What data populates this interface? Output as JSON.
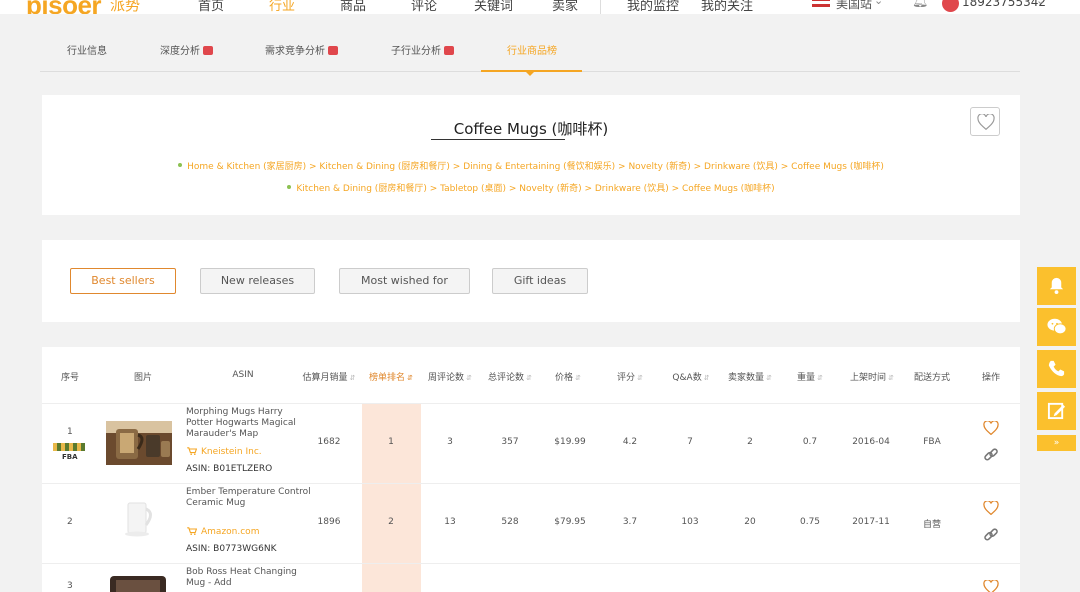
{
  "topnav": {
    "logo": "pisoer",
    "logo_cn": "派势",
    "items": [
      "首页",
      "行业",
      "商品",
      "评论",
      "关键词",
      "卖家",
      "我的监控",
      "我的关注"
    ],
    "active_index": 1,
    "country": "美国站",
    "phone": "18923755342"
  },
  "subtabs": {
    "items": [
      "行业信息",
      "深度分析",
      "需求竞争分析",
      "子行业分析",
      "行业商品榜"
    ],
    "vip": [
      false,
      true,
      true,
      true,
      false
    ],
    "active_index": 4
  },
  "category": {
    "title": "Coffee Mugs (咖啡杯)",
    "breadcrumbs": [
      "Home & Kitchen (家居厨房) > Kitchen & Dining (厨房和餐厅) > Dining & Entertaining (餐饮和娱乐) > Novelty (新奇) > Drinkware (饮具) > Coffee Mugs (咖啡杯)",
      "Kitchen & Dining (厨房和餐厅) > Tabletop (桌面) > Novelty (新奇) > Drinkware (饮具) > Coffee Mugs (咖啡杯)"
    ]
  },
  "filters": {
    "items": [
      "Best sellers",
      "New releases",
      "Most wished for",
      "Gift ideas"
    ],
    "active_index": 0
  },
  "table": {
    "headers": [
      "序号",
      "图片",
      "ASIN",
      "估算月销量",
      "榜单排名",
      "周评论数",
      "总评论数",
      "价格",
      "评分",
      "Q&A数",
      "卖家数量",
      "重量",
      "上架时间",
      "配送方式",
      "操作"
    ],
    "sortable": [
      false,
      false,
      false,
      true,
      true,
      true,
      true,
      true,
      true,
      true,
      true,
      true,
      true,
      false,
      false
    ],
    "active_header": 4,
    "rows": [
      {
        "index": "1",
        "badge": "FBA",
        "title": "Morphing Mugs Harry Potter Hogwarts Magical Marauder's Map",
        "seller": "Kneistein Inc.",
        "asin_label": "ASIN:",
        "asin": "B01ETLZERO",
        "monthly_sales": "1682",
        "rank": "1",
        "weekly_reviews": "3",
        "total_reviews": "357",
        "price": "$19.99",
        "rating": "4.2",
        "qa": "7",
        "sellers": "2",
        "weight": "0.7",
        "listed": "2016-04",
        "fulfillment": "FBA"
      },
      {
        "index": "2",
        "badge": "",
        "title": "Ember Temperature Control Ceramic Mug",
        "seller": "Amazon.com",
        "asin_label": "ASIN:",
        "asin": "B0773WG6NK",
        "monthly_sales": "1896",
        "rank": "2",
        "weekly_reviews": "13",
        "total_reviews": "528",
        "price": "$79.95",
        "rating": "3.7",
        "qa": "103",
        "sellers": "20",
        "weight": "0.75",
        "listed": "2017-11",
        "fulfillment": "自营"
      },
      {
        "index": "3",
        "badge": "",
        "title": "Bob Ross Heat Changing Mug - Add"
      }
    ]
  },
  "side_tools": {
    "collapse_label": "»"
  },
  "colors": {
    "brand": "#f5a623",
    "accent_orange": "#e0882e",
    "vip_red": "#e0474c",
    "rank_column": "#fce6d9",
    "side_tools": "#fbc02d"
  }
}
